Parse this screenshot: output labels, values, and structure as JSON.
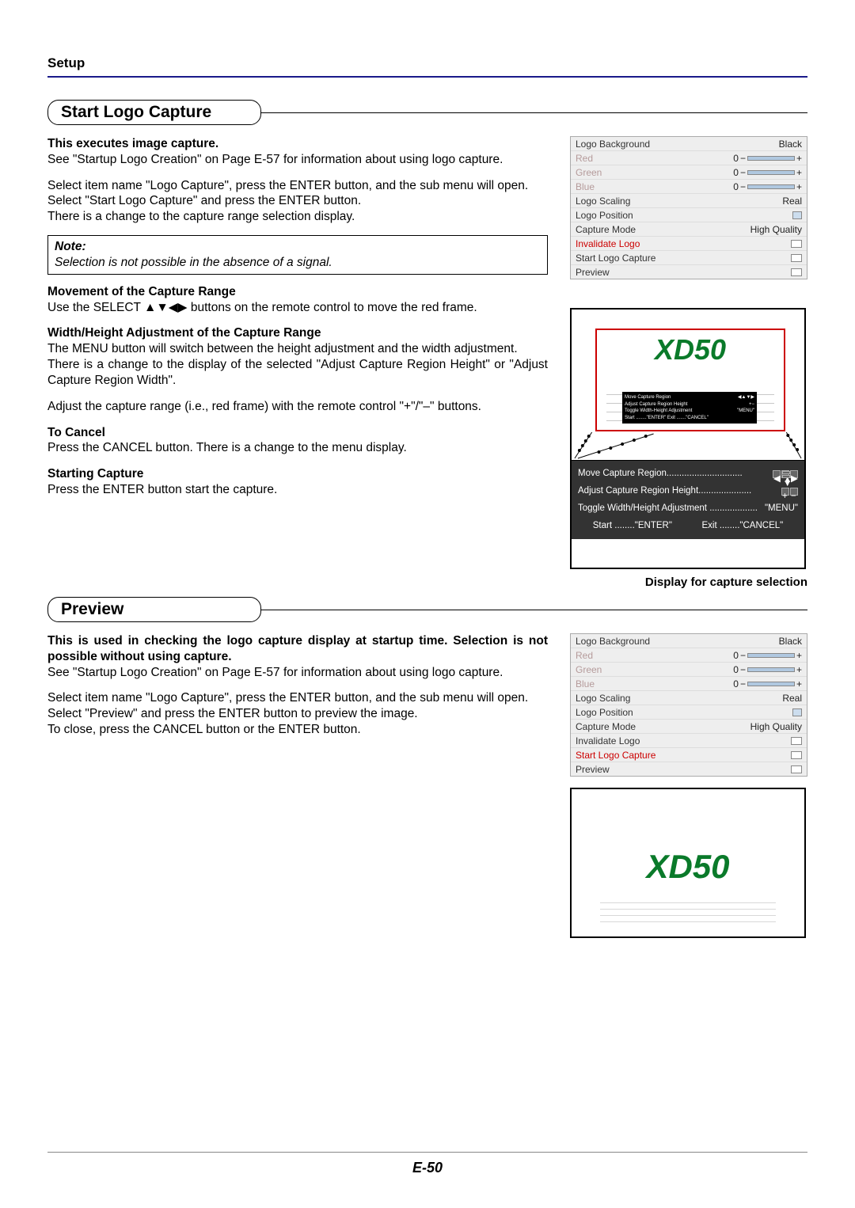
{
  "header": "Setup",
  "page_number": "E-50",
  "section1": {
    "title": "Start Logo Capture",
    "b1": "This executes image capture.",
    "p1": "See \"Startup Logo Creation\" on Page E-57 for information about using logo capture.",
    "p2a": "Select item name \"Logo Capture\", press the ENTER button, and the sub menu will open.",
    "p2b": "Select \"Start Logo Capture\" and press the ENTER button.",
    "p2c": "There is a change to the capture range selection display.",
    "note_t": "Note:",
    "note_b": "Selection is not possible in the absence of a signal.",
    "b2": "Movement of the Capture Range",
    "p3": "Use the SELECT ▲▼◀▶ buttons on the remote control to move the red frame.",
    "b3": "Width/Height Adjustment of the Capture Range",
    "p4a": "The MENU button will switch between the height adjustment and the width adjustment.",
    "p4b": "There is a change to the display of the selected \"Adjust Capture Region Height\" or \"Adjust Capture Region Width\".",
    "p5": "Adjust the capture range (i.e., red frame) with the remote control \"+\"/\"–\" buttons.",
    "b4": "To Cancel",
    "p6": "Press the CANCEL button. There is a change to the menu display.",
    "b5": "Starting Capture",
    "p7": "Press the ENTER button start the capture."
  },
  "menu1": {
    "highlight_index": 7,
    "rows": [
      {
        "label": "Logo Background",
        "val": "Black",
        "type": "text"
      },
      {
        "label": "Red",
        "val": "0",
        "type": "slider",
        "dim": true
      },
      {
        "label": "Green",
        "val": "0",
        "type": "slider",
        "dim": true
      },
      {
        "label": "Blue",
        "val": "0",
        "type": "slider",
        "dim": true
      },
      {
        "label": "Logo Scaling",
        "val": "Real",
        "type": "text"
      },
      {
        "label": "Logo Position",
        "val": "",
        "type": "square"
      },
      {
        "label": "Capture Mode",
        "val": "High Quality",
        "type": "text"
      },
      {
        "label": "Invalidate Logo",
        "val": "",
        "type": "run"
      },
      {
        "label": "Start Logo Capture",
        "val": "",
        "type": "run"
      },
      {
        "label": "Preview",
        "val": "",
        "type": "run"
      }
    ]
  },
  "capture_display": {
    "logo_text": "XD50",
    "mini": {
      "l1": "Move Capture Region",
      "l2": "Adjust Capture Region Height",
      "l3": "Toggle Width-Height Adjustment",
      "l3v": "\"MENU\"",
      "l4": "Start ........\"ENTER\"    Exit .......\"CANCEL\""
    },
    "osd": {
      "r1l": "Move Capture Region..............................",
      "r2l": "Adjust Capture Region Height.....................",
      "r3l": "Toggle Width/Height Adjustment ................... ",
      "r3v": "\"MENU\"",
      "r4l": "Start ........\"ENTER\"",
      "r4r": "Exit ........\"CANCEL\""
    },
    "caption": "Display for capture selection"
  },
  "section2": {
    "title": "Preview",
    "b1": "This is used in checking the logo capture display at startup time. Selection is not possible without using capture.",
    "p1": "See \"Startup Logo Creation\" on Page E-57 for information about using logo capture.",
    "p2a": "Select item name \"Logo Capture\", press the ENTER button, and the sub menu will open.",
    "p2b": "Select \"Preview\" and press the ENTER button to preview the image.",
    "p2c": "To close, press the CANCEL button or the ENTER button."
  },
  "menu2": {
    "highlight_index": 8,
    "rows": [
      {
        "label": "Logo Background",
        "val": "Black",
        "type": "text"
      },
      {
        "label": "Red",
        "val": "0",
        "type": "slider",
        "dim": true
      },
      {
        "label": "Green",
        "val": "0",
        "type": "slider",
        "dim": true
      },
      {
        "label": "Blue",
        "val": "0",
        "type": "slider",
        "dim": true
      },
      {
        "label": "Logo Scaling",
        "val": "Real",
        "type": "text"
      },
      {
        "label": "Logo Position",
        "val": "",
        "type": "square"
      },
      {
        "label": "Capture Mode",
        "val": "High Quality",
        "type": "text"
      },
      {
        "label": "Invalidate Logo",
        "val": "",
        "type": "run"
      },
      {
        "label": "Start Logo Capture",
        "val": "",
        "type": "run"
      },
      {
        "label": "Preview",
        "val": "",
        "type": "run"
      }
    ]
  },
  "preview_display": {
    "logo_text": "XD50"
  }
}
